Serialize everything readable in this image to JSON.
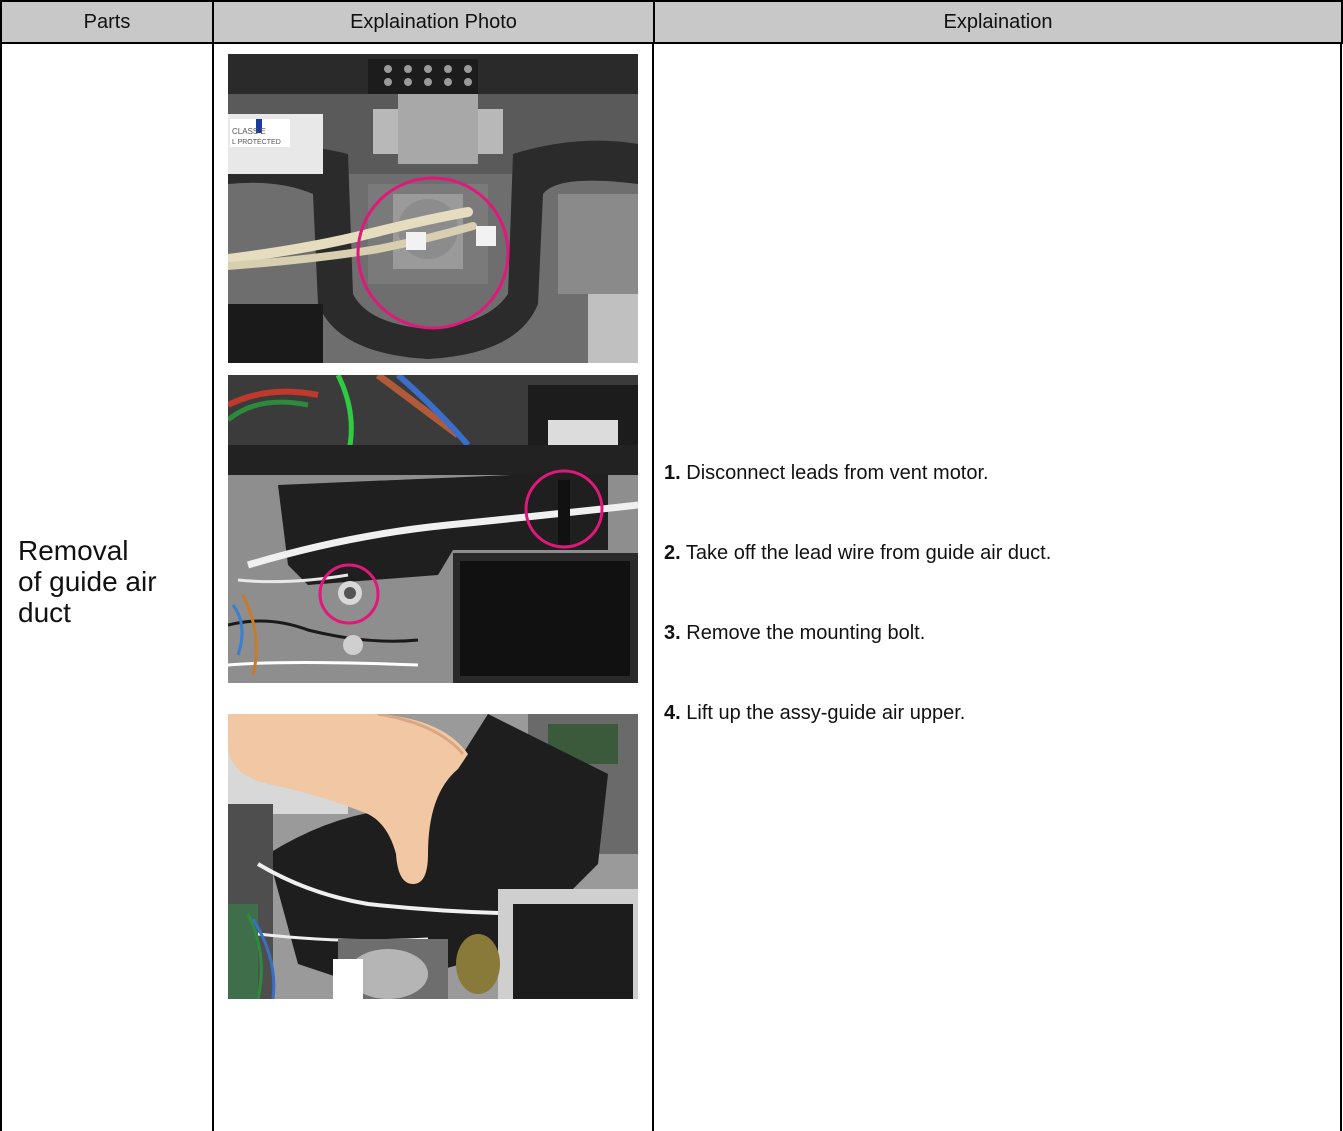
{
  "table": {
    "headers": {
      "parts": "Parts",
      "photo": "Explaination Photo",
      "explanation": "Explaination"
    },
    "row": {
      "part_name_lines": [
        "Removal",
        "of guide air",
        "duct"
      ],
      "steps": [
        {
          "number": "1.",
          "text": "Disconnect leads from vent motor."
        },
        {
          "number": "2.",
          "text": "Take off the lead wire from guide air duct."
        },
        {
          "number": "3.",
          "text": "Remove the mounting bolt."
        },
        {
          "number": "4.",
          "text": "Lift up the assy-guide air upper."
        }
      ]
    }
  },
  "colors": {
    "header_bg": "#c8c8c8",
    "highlight_circle": "#e0187a",
    "grid_line": "#000000"
  },
  "photos": [
    {
      "subject": "vent-motor-connector",
      "highlight_count": 1
    },
    {
      "subject": "lead-wire-and-bolt",
      "highlight_count": 2
    },
    {
      "subject": "lifting-guide-air-upper",
      "highlight_count": 0
    }
  ]
}
